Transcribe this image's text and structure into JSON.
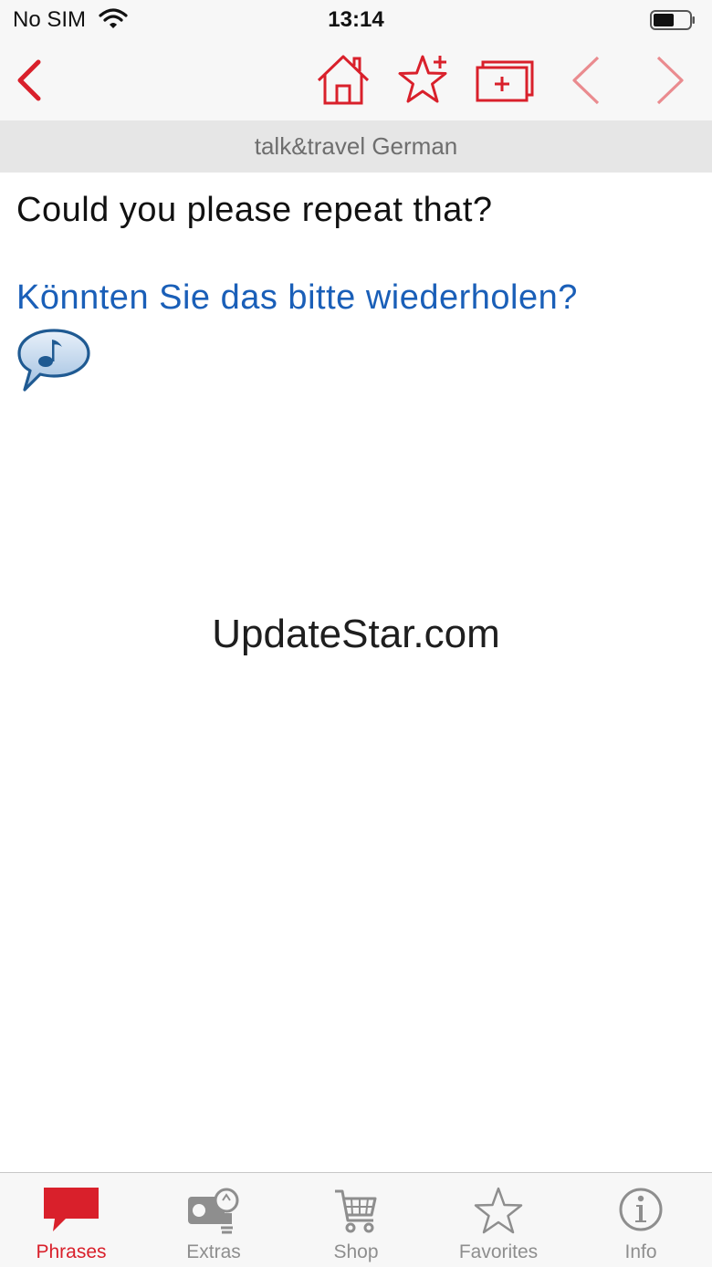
{
  "status_bar": {
    "carrier": "No SIM",
    "time": "13:14"
  },
  "nav": {
    "back_icon": "chevron-left-icon",
    "home_icon": "home-icon",
    "add_favorite_icon": "star-plus-icon",
    "add_to_deck_icon": "cards-plus-icon",
    "prev_icon": "chevron-left-icon",
    "next_icon": "chevron-right-icon",
    "accent_color": "#d9202b"
  },
  "title": "talk&travel German",
  "phrase": {
    "english": "Could you please repeat that?",
    "german": "Könnten Sie das bitte wiederholen?",
    "audio_icon": "speech-bubble-music-icon"
  },
  "watermark": "UpdateStar.com",
  "tabs": [
    {
      "label": "Phrases",
      "icon": "speech-bubble-icon",
      "active": true
    },
    {
      "label": "Extras",
      "icon": "projector-bulb-icon",
      "active": false
    },
    {
      "label": "Shop",
      "icon": "cart-icon",
      "active": false
    },
    {
      "label": "Favorites",
      "icon": "star-icon",
      "active": false
    },
    {
      "label": "Info",
      "icon": "info-icon",
      "active": false
    }
  ]
}
